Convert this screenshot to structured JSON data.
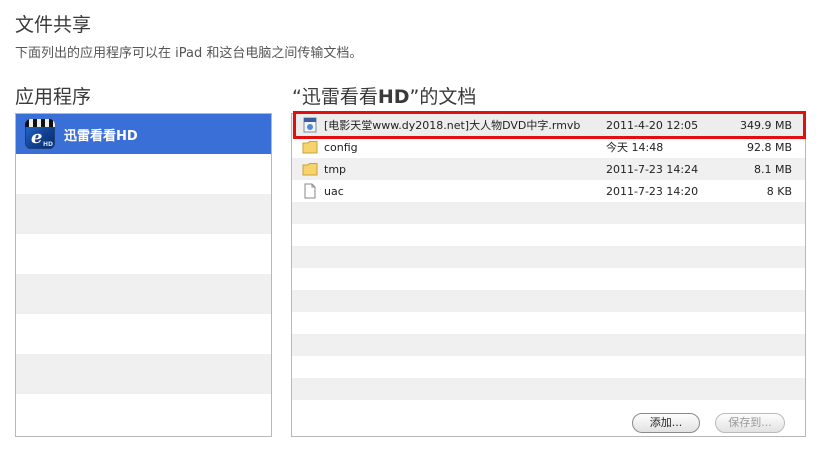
{
  "header": {
    "title": "文件共享",
    "subtitle": "下面列出的应用程序可以在 iPad 和这台电脑之间传输文档。"
  },
  "apps": {
    "title": "应用程序",
    "items": [
      {
        "label": "迅雷看看HD",
        "selected": true,
        "icon": "xunlei-hd-app-icon"
      }
    ]
  },
  "documents": {
    "title_prefix": "“迅雷看看",
    "title_bold": "HD",
    "title_suffix": "”的文档",
    "files": [
      {
        "name": "[电影天堂www.dy2018.net]大人物DVD中字.rmvb",
        "date": "2011-4-20 12:05",
        "size": "349.9 MB",
        "icon": "video-file-icon"
      },
      {
        "name": "config",
        "date": "今天 14:48",
        "size": "92.8 MB",
        "icon": "folder-icon"
      },
      {
        "name": "tmp",
        "date": "2011-7-23 14:24",
        "size": "8.1 MB",
        "icon": "folder-icon"
      },
      {
        "name": "uac",
        "date": "2011-7-23 14:20",
        "size": "8 KB",
        "icon": "document-icon"
      }
    ],
    "add_button": "添加...",
    "save_button": "保存到..."
  },
  "colors": {
    "selection": "#3b6fd8",
    "highlight_border": "#e01010",
    "stripe": "#f0f0f0"
  }
}
